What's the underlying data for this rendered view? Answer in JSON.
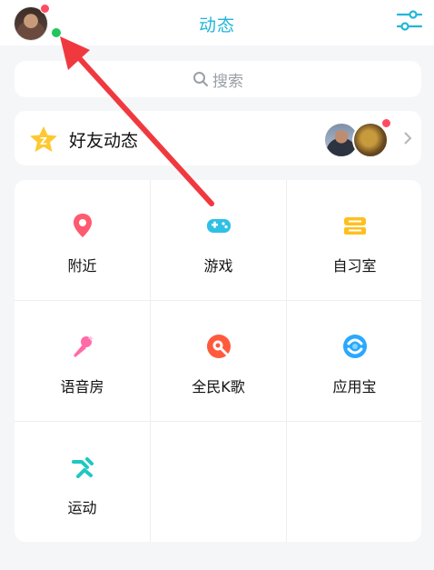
{
  "header": {
    "title": "动态",
    "accent_color": "#22b6d8",
    "left_icon": "avatar",
    "right_icon": "filter-sliders-icon"
  },
  "search": {
    "placeholder": "搜索",
    "icon": "search-icon"
  },
  "friends_feed": {
    "label": "好友动态",
    "icon": "qzone-star-icon",
    "badge_color": "#ff4b63"
  },
  "grid": {
    "items": [
      {
        "label": "附近",
        "icon": "location-pin-icon",
        "color": "#ff5a6e"
      },
      {
        "label": "游戏",
        "icon": "gamepad-icon",
        "color": "#2fc0e6"
      },
      {
        "label": "自习室",
        "icon": "study-room-icon",
        "color": "#ffbf1f"
      },
      {
        "label": "语音房",
        "icon": "microphone-icon",
        "color": "#ff6aa8"
      },
      {
        "label": "全民K歌",
        "icon": "karaoke-icon",
        "color": "#ff5a3c"
      },
      {
        "label": "应用宝",
        "icon": "app-store-icon",
        "color": "#2aa8ff"
      },
      {
        "label": "运动",
        "icon": "running-icon",
        "color": "#20c7c2"
      }
    ]
  },
  "annotation": {
    "arrow_color": "#f0393f"
  }
}
